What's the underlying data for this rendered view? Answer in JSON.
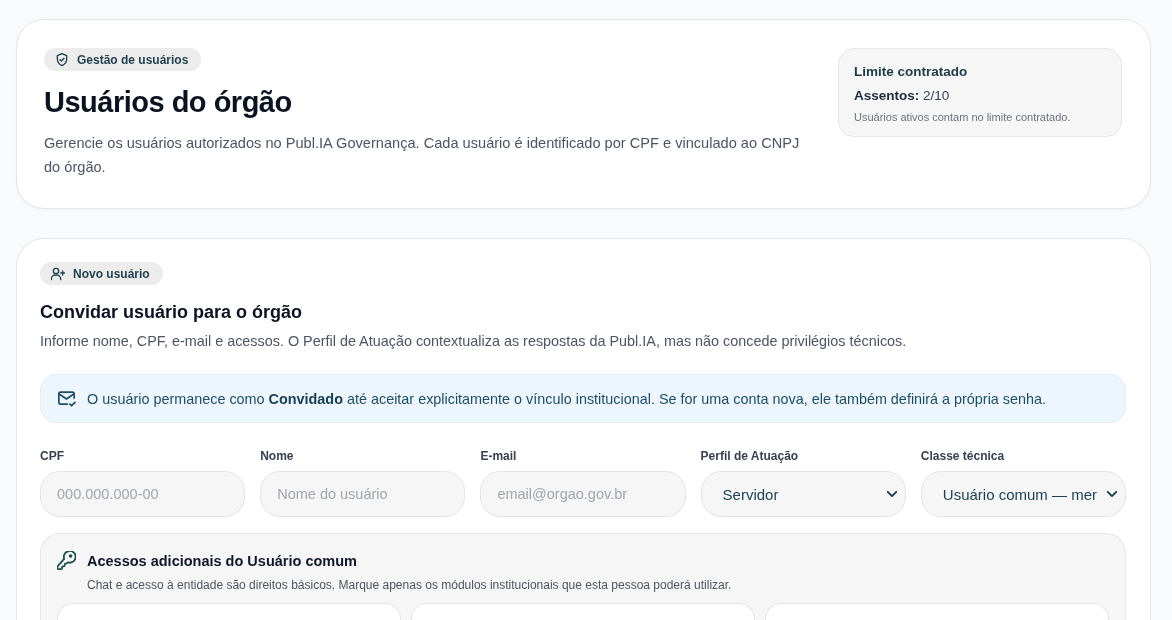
{
  "header_card": {
    "badge": {
      "label": "Gestão de usuários"
    },
    "title": "Usuários do órgão",
    "description": "Gerencie os usuários autorizados no Publ.IA Governança. Cada usuário é identificado por CPF e vinculado ao CNPJ do órgão.",
    "limit": {
      "title": "Limite contratado",
      "seats": "**Assentos:** 2/10",
      "note": "Usuários ativos contam no limite contratado."
    }
  },
  "invite_card": {
    "badge": {
      "label": "Novo usuário"
    },
    "title": "Convidar usuário para o órgão",
    "description": "Informe nome, CPF, e-mail e acessos. O Perfil de Atuação contextualiza as respostas da Publ.IA, mas não concede privilégios técnicos.",
    "notice": "O usuário permanece como **Convidado** até aceitar explicitamente o vínculo institucional. Se for uma conta nova, ele também definirá a própria senha.",
    "fields": [
      {
        "kind": "input",
        "label": "CPF",
        "placeholder": "000.000.000-00"
      },
      {
        "kind": "input",
        "label": "Nome",
        "placeholder": "Nome do usuário"
      },
      {
        "kind": "input",
        "label": "E-mail",
        "placeholder": "email@orgao.gov.br"
      },
      {
        "kind": "select",
        "label": "Perfil de Atuação",
        "value": "Servidor"
      },
      {
        "kind": "select",
        "label": "Classe técnica",
        "value": "Usuário comum — mer"
      }
    ],
    "access_panel": {
      "title": "Acessos adicionais do Usuário comum",
      "description": "Chat e acesso à entidade são direitos básicos. Marque apenas os módulos institucionais que esta pessoa poderá utilizar."
    }
  }
}
